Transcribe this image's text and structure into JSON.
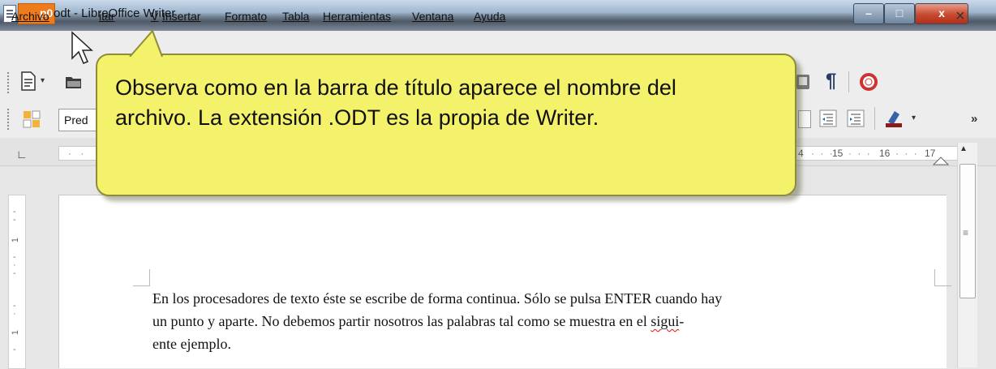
{
  "window": {
    "title": "odt - LibreOffice Writer",
    "tag_label": "p0",
    "minimize_glyph": "–",
    "maximize_glyph": "□",
    "close_glyph": "x"
  },
  "menubar": {
    "items": [
      "Archivo",
      "Editar",
      "Ver",
      "Insertar",
      "Formato",
      "Tabla",
      "Herramientas",
      "Ventana",
      "Ayuda"
    ],
    "visible_labels": [
      "Archivo",
      "itar",
      "V",
      "Insertar",
      "Formato",
      "Tabla",
      "Herramientas",
      "Ventana",
      "Ayuda"
    ],
    "close_glyph": "×"
  },
  "toolbar": {
    "style_value": "Pred",
    "overflow_glyph": "»"
  },
  "ruler": {
    "numbers": [
      "4",
      "15",
      "16",
      "17"
    ]
  },
  "vertical_ruler": {
    "numbers": [
      "1",
      "1"
    ]
  },
  "callout": {
    "text_line1": "Observa como en la barra de título aparece el nombre del",
    "text_line2": "archivo. La extensión .ODT es la propia de Writer."
  },
  "document": {
    "line1": "En los procesadores de texto éste se escribe de forma continua. Sólo se pulsa ENTER cuando hay",
    "line2_a": "un punto y aparte. No debemos partir nosotros las palabras tal como se muestra en el ",
    "line2_b": "sigui",
    "line2_c": "-",
    "line3": "ente ejemplo."
  },
  "colors": {
    "callout_fill": "#f4f26b",
    "tag_orange": "#ef7b1f",
    "close_red": "#c64a2e"
  },
  "icons": [
    "document-icon",
    "new-document-icon",
    "open-folder-icon",
    "formatting-marks-icon",
    "help-lifebuoy-icon",
    "styles-icon",
    "indent-decrease-icon",
    "indent-increase-icon",
    "highlight-icon",
    "mouse-pointer-icon"
  ]
}
